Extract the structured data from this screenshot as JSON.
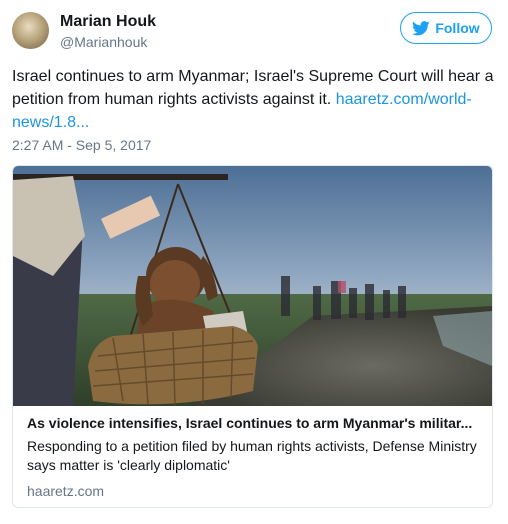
{
  "author": {
    "display_name": "Marian Houk",
    "screen_name": "@Marianhouk"
  },
  "follow_button": {
    "label": "Follow",
    "icon": "twitter-bird-icon",
    "color": "#1da1f2"
  },
  "tweet": {
    "text": "Israel continues to arm Myanmar; Israel's Supreme Court will hear a petition from human rights activists against it. ",
    "link_text": "haaretz.com/world-news/1.8...",
    "timestamp": "2:27 AM - Sep 5, 2017"
  },
  "card": {
    "title": "As violence intensifies, Israel continues to arm Myanmar's militar...",
    "description": "Responding to a petition filed by human rights activists, Defense Ministry says matter is 'clearly diplomatic'",
    "domain": "haaretz.com"
  },
  "colors": {
    "link": "#1b95e0",
    "secondary_text": "#657786",
    "border": "#e1e8ed"
  }
}
